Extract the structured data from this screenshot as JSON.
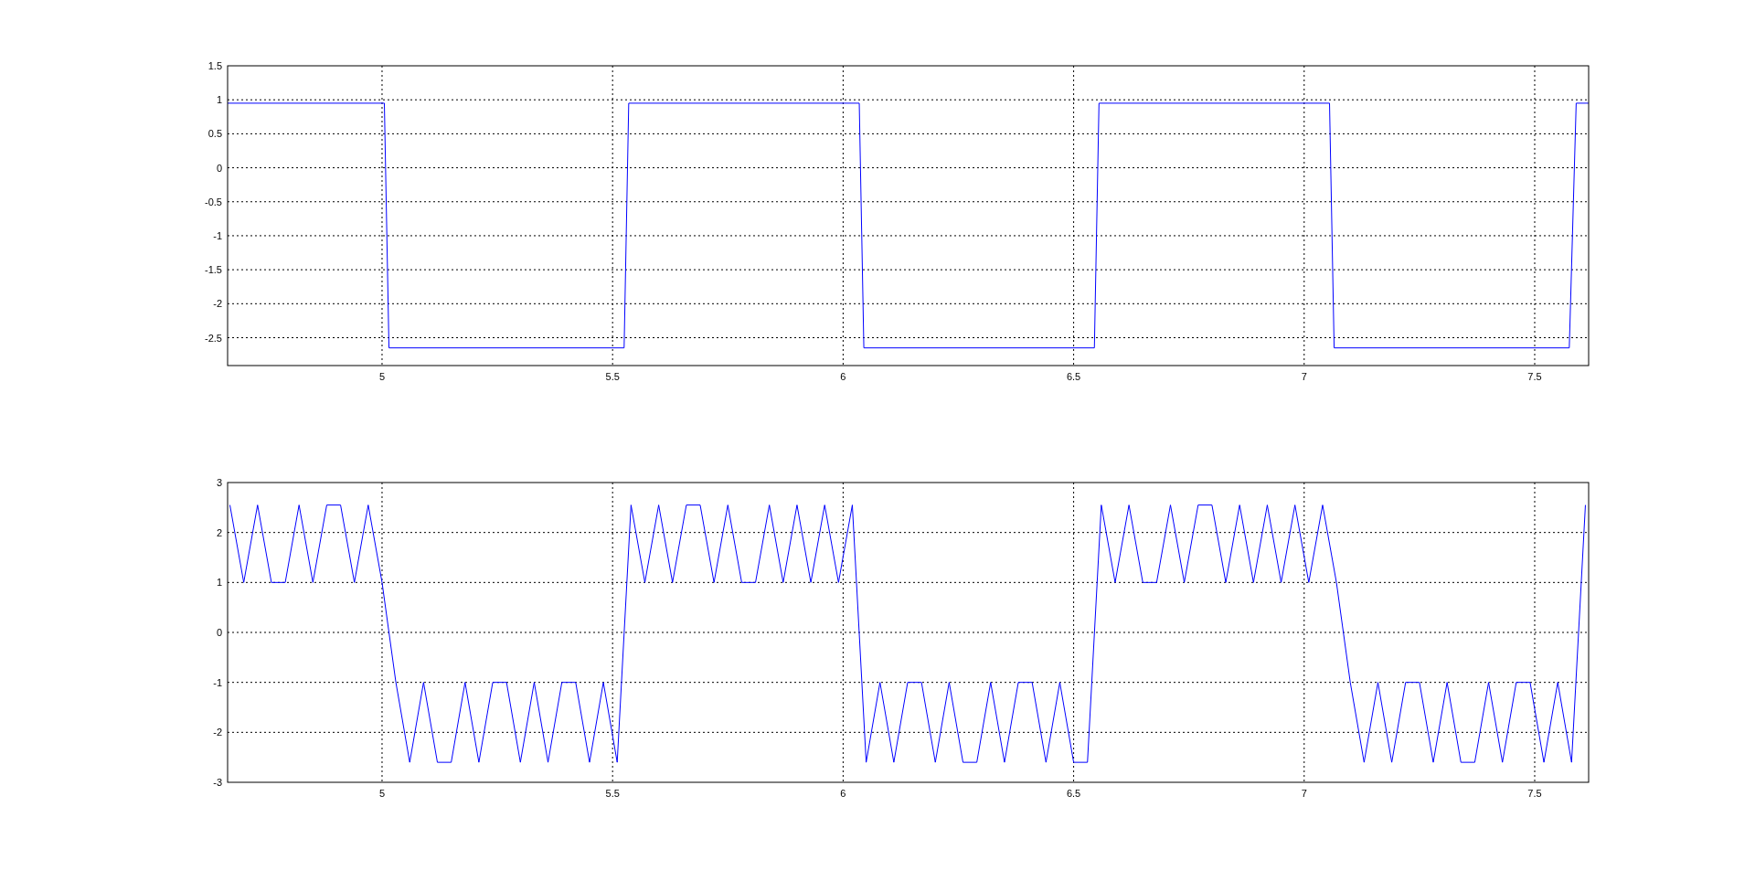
{
  "figure": {
    "axes": [
      {
        "chart_data": {
          "type": "line",
          "grid": true,
          "xlim": [
            4.665,
            7.617
          ],
          "ylim": [
            -2.91,
            1.5
          ],
          "xticks": [
            5,
            5.5,
            6,
            6.5,
            7,
            7.5
          ],
          "yticks": [
            -2.5,
            -2,
            -1.5,
            -1,
            -0.5,
            0,
            0.5,
            1,
            1.5
          ],
          "x": [
            4.665,
            5.005,
            5.015,
            5.525,
            5.535,
            6.035,
            6.045,
            6.545,
            6.555,
            7.055,
            7.065,
            7.575,
            7.59,
            7.617
          ],
          "series": [
            {
              "color": "#0000ff",
              "values": [
                0.95,
                0.95,
                -2.65,
                -2.65,
                0.95,
                0.95,
                -2.65,
                -2.65,
                0.95,
                0.95,
                -2.65,
                -2.65,
                0.95,
                0.95
              ]
            }
          ]
        }
      },
      {
        "chart_data": {
          "type": "line",
          "grid": true,
          "xlim": [
            4.665,
            7.617
          ],
          "ylim": [
            -3,
            3
          ],
          "xticks": [
            5,
            5.5,
            6,
            6.5,
            7,
            7.5
          ],
          "yticks": [
            -3,
            -2,
            -1,
            0,
            1,
            2,
            3
          ],
          "x": [
            4.67,
            4.7,
            4.73,
            4.76,
            4.79,
            4.82,
            4.85,
            4.88,
            4.91,
            4.94,
            4.97,
            5.0,
            5.03,
            5.06,
            5.09,
            5.12,
            5.15,
            5.18,
            5.21,
            5.24,
            5.27,
            5.3,
            5.33,
            5.36,
            5.39,
            5.42,
            5.45,
            5.48,
            5.51,
            5.54,
            5.57,
            5.6,
            5.63,
            5.66,
            5.69,
            5.72,
            5.75,
            5.78,
            5.81,
            5.84,
            5.87,
            5.9,
            5.93,
            5.96,
            5.99,
            6.02,
            6.05,
            6.08,
            6.11,
            6.14,
            6.17,
            6.2,
            6.23,
            6.26,
            6.29,
            6.32,
            6.35,
            6.38,
            6.41,
            6.44,
            6.47,
            6.5,
            6.53,
            6.56,
            6.59,
            6.62,
            6.65,
            6.68,
            6.71,
            6.74,
            6.77,
            6.8,
            6.83,
            6.86,
            6.89,
            6.92,
            6.95,
            6.98,
            7.01,
            7.04,
            7.07,
            7.1,
            7.13,
            7.16,
            7.19,
            7.22,
            7.25,
            7.28,
            7.31,
            7.34,
            7.37,
            7.4,
            7.43,
            7.46,
            7.49,
            7.52,
            7.55,
            7.58,
            7.61
          ],
          "series": [
            {
              "color": "#0000ff",
              "values": [
                2.55,
                1,
                2.55,
                1,
                1,
                2.55,
                1,
                2.55,
                2.55,
                1,
                2.55,
                1,
                -1,
                -2.6,
                -1,
                -2.6,
                -2.6,
                -1,
                -2.6,
                -1,
                -1,
                -2.6,
                -1,
                -2.6,
                -1,
                -1,
                -2.6,
                -1,
                -2.6,
                2.55,
                1,
                2.55,
                1,
                2.55,
                2.55,
                1,
                2.55,
                1,
                1,
                2.55,
                1,
                2.55,
                1,
                2.55,
                1,
                2.55,
                -2.6,
                -1,
                -2.6,
                -1,
                -1,
                -2.6,
                -1,
                -2.6,
                -2.6,
                -1,
                -2.6,
                -1,
                -1,
                -2.6,
                -1,
                -2.6,
                -2.6,
                2.55,
                1,
                2.55,
                1,
                1,
                2.55,
                1,
                2.55,
                2.55,
                1,
                2.55,
                1,
                2.55,
                1,
                2.55,
                1,
                2.55,
                1,
                -1,
                -2.6,
                -1,
                -2.6,
                -1,
                -1,
                -2.6,
                -1,
                -2.6,
                -2.6,
                -1,
                -2.6,
                -1,
                -1,
                -2.6,
                -1,
                -2.6,
                2.55
              ]
            }
          ]
        }
      }
    ]
  }
}
